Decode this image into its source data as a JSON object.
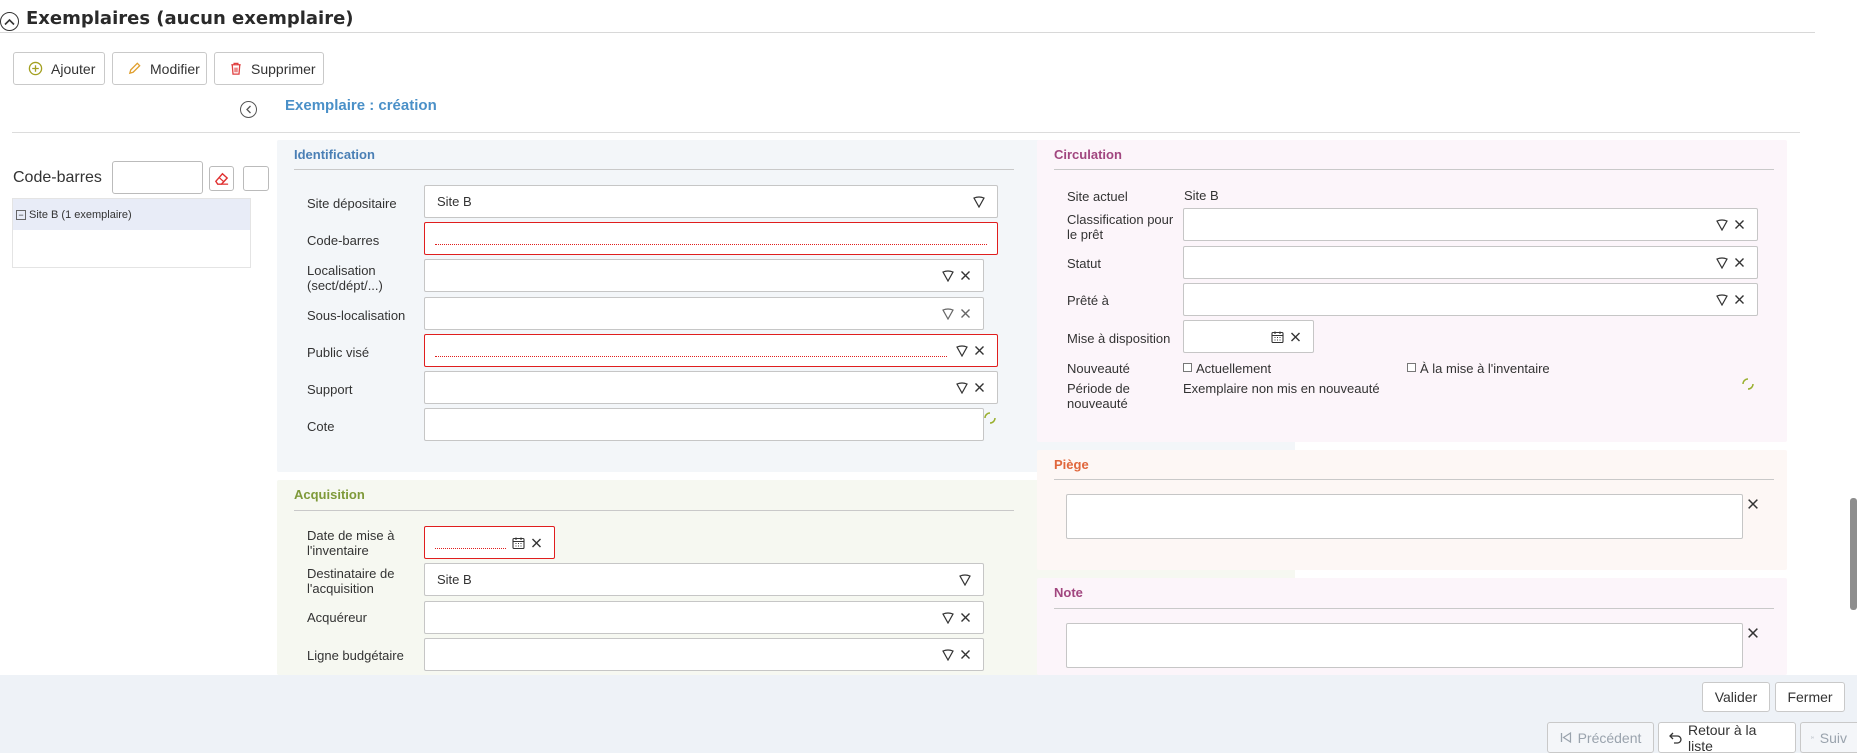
{
  "header": {
    "title": "Exemplaires (aucun exemplaire)"
  },
  "toolbar": {
    "add": "Ajouter",
    "edit": "Modifier",
    "delete": "Supprimer"
  },
  "form": {
    "title": "Exemplaire : création"
  },
  "left_panel": {
    "barcode_label": "Code-barres",
    "tree_item": "Site B (1 exemplaire)"
  },
  "identification": {
    "title": "Identification",
    "site_label": "Site dépositaire",
    "site_value": "Site B",
    "barcode_label": "Code-barres",
    "location_label": "Localisation (sect/dépt/...)",
    "sublocation_label": "Sous-localisation",
    "audience_label": "Public visé",
    "support_label": "Support",
    "cote_label": "Cote"
  },
  "acquisition": {
    "title": "Acquisition",
    "date_label": "Date de mise à l'inventaire",
    "recipient_label": "Destinataire de l'acquisition",
    "recipient_value": "Site B",
    "buyer_label": "Acquéreur",
    "budget_label": "Ligne budgétaire"
  },
  "circulation": {
    "title": "Circulation",
    "site_label": "Site actuel",
    "site_value": "Site B",
    "class_label": "Classification pour le prêt",
    "status_label": "Statut",
    "loaned_label": "Prêté à",
    "available_label": "Mise à disposition",
    "novelty_label": "Nouveauté",
    "novelty_current": "Actuellement",
    "novelty_inventory": "À la mise à l'inventaire",
    "period_label": "Période de nouveauté",
    "period_value": "Exemplaire non mis en nouveauté"
  },
  "piege": {
    "title": "Piège"
  },
  "note": {
    "title": "Note"
  },
  "footer": {
    "validate": "Valider",
    "close": "Fermer",
    "prev": "Précédent",
    "back": "Retour à la liste",
    "next": "Suiv"
  },
  "colors": {
    "identification": "#4a7fb5",
    "acquisition": "#7f9a3a",
    "circulation": "#a1467f",
    "piege": "#e0663b",
    "note": "#a1467f",
    "error": "#e01e1e"
  }
}
